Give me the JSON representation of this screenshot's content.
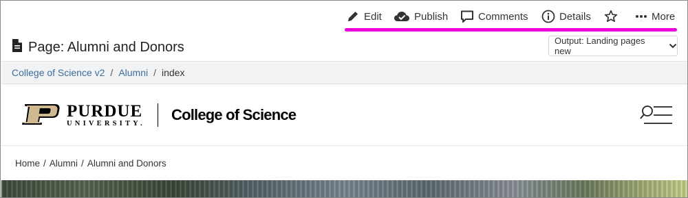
{
  "toolbar": {
    "edit": "Edit",
    "publish": "Publish",
    "comments": "Comments",
    "details": "Details",
    "favorite_icon": "star-icon",
    "more": "More",
    "highlight_color": "#ee00dd"
  },
  "page": {
    "title": "Page: Alumni and Donors",
    "icon": "document-icon"
  },
  "output": {
    "label": "Output: Landing pages new"
  },
  "cms_breadcrumb": {
    "items": [
      "College of Science v2",
      "Alumni"
    ],
    "current": "index",
    "separator": "/",
    "link_color": "#3c6d9e"
  },
  "site_header": {
    "logo_line1": "PURDUE",
    "logo_line2": "UNIVERSITY.",
    "college": "College of Science",
    "logo_gold": "#cfb991"
  },
  "site_breadcrumb": {
    "items": [
      "Home",
      "Alumni",
      "Alumni and Donors"
    ],
    "separator": "/"
  }
}
